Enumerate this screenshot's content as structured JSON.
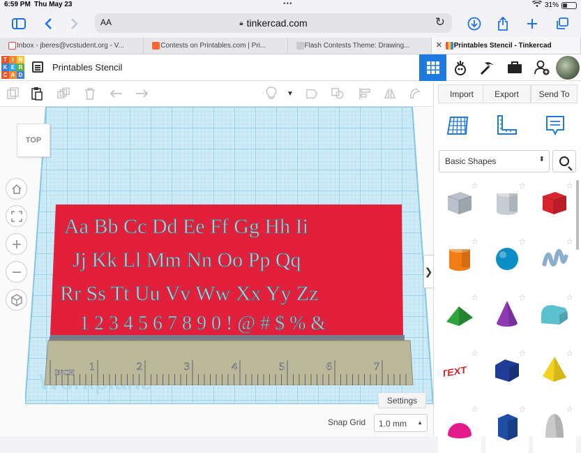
{
  "status_bar": {
    "time": "6:59 PM",
    "date": "Thu May 23",
    "battery": "31%"
  },
  "browser": {
    "url": "tinkercad.com",
    "aa_label": "AA",
    "tabs": [
      {
        "label": "Inbox - jberes@vcstudent.org - V...",
        "icon_color": "#ea4335"
      },
      {
        "label": "Contests on Printables.com | Pri...",
        "icon_color": "#fa6831"
      },
      {
        "label": "Flash Contests Theme: Drawing...",
        "icon_color": "#c9c9c9"
      },
      {
        "label": "Printables Stencil - Tinkercad",
        "icon_color": "#1f7ae0"
      }
    ]
  },
  "tinkercad": {
    "logo_letters": [
      "T",
      "I",
      "N",
      "K",
      "E",
      "R",
      "C",
      "A",
      "D"
    ],
    "logo_colors": [
      "#e9552f",
      "#ee8a2b",
      "#f4c33d",
      "#3b7fd8",
      "#2ea8e0",
      "#63b146",
      "#e9552f",
      "#ee8a2b",
      "#3b7fd8"
    ],
    "project_title": "Printables Stencil",
    "header_icons": [
      "grid-view-icon",
      "lab-tools-icon",
      "pickaxe-icon",
      "briefcase-icon",
      "add-user-icon"
    ]
  },
  "right_panel": {
    "import_label": "Import",
    "export_label": "Export",
    "sendto_label": "Send To",
    "category": "Basic Shapes",
    "shapes": [
      {
        "name": "Box",
        "color": "#b9c2cc"
      },
      {
        "name": "Cylinder",
        "color": "#c7ccd2"
      },
      {
        "name": "Box",
        "color": "#d9232f"
      },
      {
        "name": "Cylinder",
        "color": "#f07d15"
      },
      {
        "name": "Sphere",
        "color": "#0d8dc6"
      },
      {
        "name": "Scribble",
        "color": "#8aaecc"
      },
      {
        "name": "Roof",
        "color": "#2ea43a"
      },
      {
        "name": "Cone",
        "color": "#8e3ab5"
      },
      {
        "name": "Round Roof",
        "color": "#5cc0cf"
      },
      {
        "name": "Text",
        "color": "#d3222a"
      },
      {
        "name": "Polygon",
        "color": "#1f3c96"
      },
      {
        "name": "Pyramid",
        "color": "#f2d21f"
      },
      {
        "name": "Half Sphere",
        "color": "#e21a8a"
      },
      {
        "name": "Polygon",
        "color": "#1f4ea6"
      },
      {
        "name": "Paraboloid",
        "color": "#c9c9c9"
      }
    ]
  },
  "workplane": {
    "view_label": "TOP",
    "watermark": "Workplane",
    "settings_label": "Settings",
    "snap_label": "Snap Grid",
    "snap_value": "1.0 mm",
    "stencil_rows": [
      "Aa Bb Cc Dd Ee Ff Gg Hh Ii",
      "Jj Kk Ll Mm Nn Oo Pp Qq",
      "Rr Ss Tt Uu Vv Ww Xx Yy Zz",
      "1 2 3 4 5 6 7 8 9 0 ! @ # $ % &"
    ],
    "ruler_unit": "INCH",
    "ruler_numbers": [
      "1",
      "2",
      "3",
      "4",
      "5",
      "6",
      "7"
    ],
    "stencil_color": "#e3203b",
    "ruler_color": "#bcb89a"
  }
}
